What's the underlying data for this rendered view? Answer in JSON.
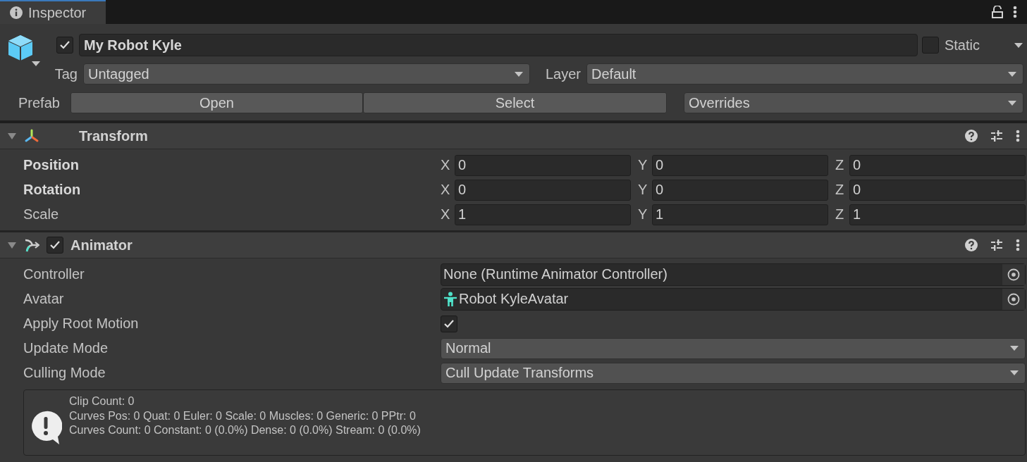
{
  "tab": {
    "title": "Inspector"
  },
  "header": {
    "active": true,
    "name": "My Robot Kyle",
    "static": false,
    "static_label": "Static",
    "tag_label": "Tag",
    "tag": "Untagged",
    "layer_label": "Layer",
    "layer": "Default",
    "prefab_label": "Prefab",
    "prefab_buttons": [
      "Open",
      "Select"
    ],
    "overrides": "Overrides"
  },
  "components": [
    {
      "kind": "transform",
      "title": "Transform",
      "expanded": true,
      "rows": [
        {
          "kind": "vector",
          "label": "Position",
          "overridden": true,
          "axes": [
            {
              "axis": "X",
              "value": "0"
            },
            {
              "axis": "Y",
              "value": "0"
            },
            {
              "axis": "Z",
              "value": "0"
            }
          ]
        },
        {
          "kind": "vector",
          "label": "Rotation",
          "overridden": true,
          "axes": [
            {
              "axis": "X",
              "value": "0"
            },
            {
              "axis": "Y",
              "value": "0"
            },
            {
              "axis": "Z",
              "value": "0"
            }
          ]
        },
        {
          "kind": "vector",
          "label": "Scale",
          "overridden": false,
          "axes": [
            {
              "axis": "X",
              "value": "1"
            },
            {
              "axis": "Y",
              "value": "1"
            },
            {
              "axis": "Z",
              "value": "1"
            }
          ]
        }
      ]
    },
    {
      "kind": "animator",
      "title": "Animator",
      "enabled": true,
      "expanded": true,
      "rows": [
        {
          "kind": "object",
          "label": "Controller",
          "value": "None (Runtime Animator Controller)",
          "icon": false
        },
        {
          "kind": "object",
          "label": "Avatar",
          "value": "Robot KyleAvatar",
          "icon": true
        },
        {
          "kind": "checkbox",
          "label": "Apply Root Motion",
          "checked": true
        },
        {
          "kind": "dropdown",
          "label": "Update Mode",
          "value": "Normal"
        },
        {
          "kind": "dropdown",
          "label": "Culling Mode",
          "value": "Cull Update Transforms"
        }
      ],
      "help": [
        "Clip Count: 0",
        "Curves Pos: 0 Quat: 0 Euler: 0 Scale: 0 Muscles: 0 Generic: 0 PPtr: 0",
        "Curves Count: 0 Constant: 0 (0.0%) Dense: 0 (0.0%) Stream: 0 (0.0%)"
      ]
    }
  ]
}
